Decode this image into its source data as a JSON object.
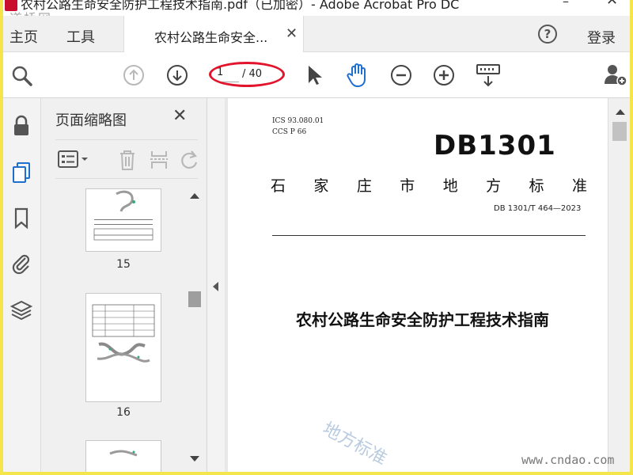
{
  "window": {
    "title": "农村公路生命安全防护工程技术指南.pdf（已加密）- Adobe Acrobat Pro DC",
    "minimize": "–",
    "close": "✕"
  },
  "site_logo": "道桥网",
  "nav": {
    "home": "主页",
    "tools": "工具",
    "tab_label": "农村公路生命安全...",
    "tab_close": "✕",
    "help": "?",
    "login": "登录"
  },
  "toolbar": {
    "page_current": "1",
    "page_total": "/ 40",
    "icons": [
      "search-icon",
      "prev-page-icon",
      "next-page-icon",
      "select-cursor-icon",
      "hand-tool-icon",
      "zoom-out-icon",
      "zoom-in-icon",
      "keyboard-scroll-icon",
      "add-user-icon"
    ]
  },
  "left_tools": [
    "lock-icon",
    "pages-icon",
    "bookmark-icon",
    "attachment-icon",
    "layers-icon"
  ],
  "thumb_panel": {
    "title": "页面缩略图",
    "close": "✕",
    "pages": [
      {
        "number": "15"
      },
      {
        "number": "16"
      }
    ]
  },
  "document": {
    "ics": "ICS  93.080.01",
    "ccs": "CCS  P 66",
    "db_code": "DB1301",
    "issuer_chars": [
      "石",
      "家",
      "庄",
      "市",
      "地",
      "方",
      "标",
      "准"
    ],
    "standard_number": "DB 1301/T 464—2023",
    "title": "农村公路生命安全防护工程技术指南",
    "watermark": "地方标准"
  },
  "site_watermark": "www.cndao.com"
}
